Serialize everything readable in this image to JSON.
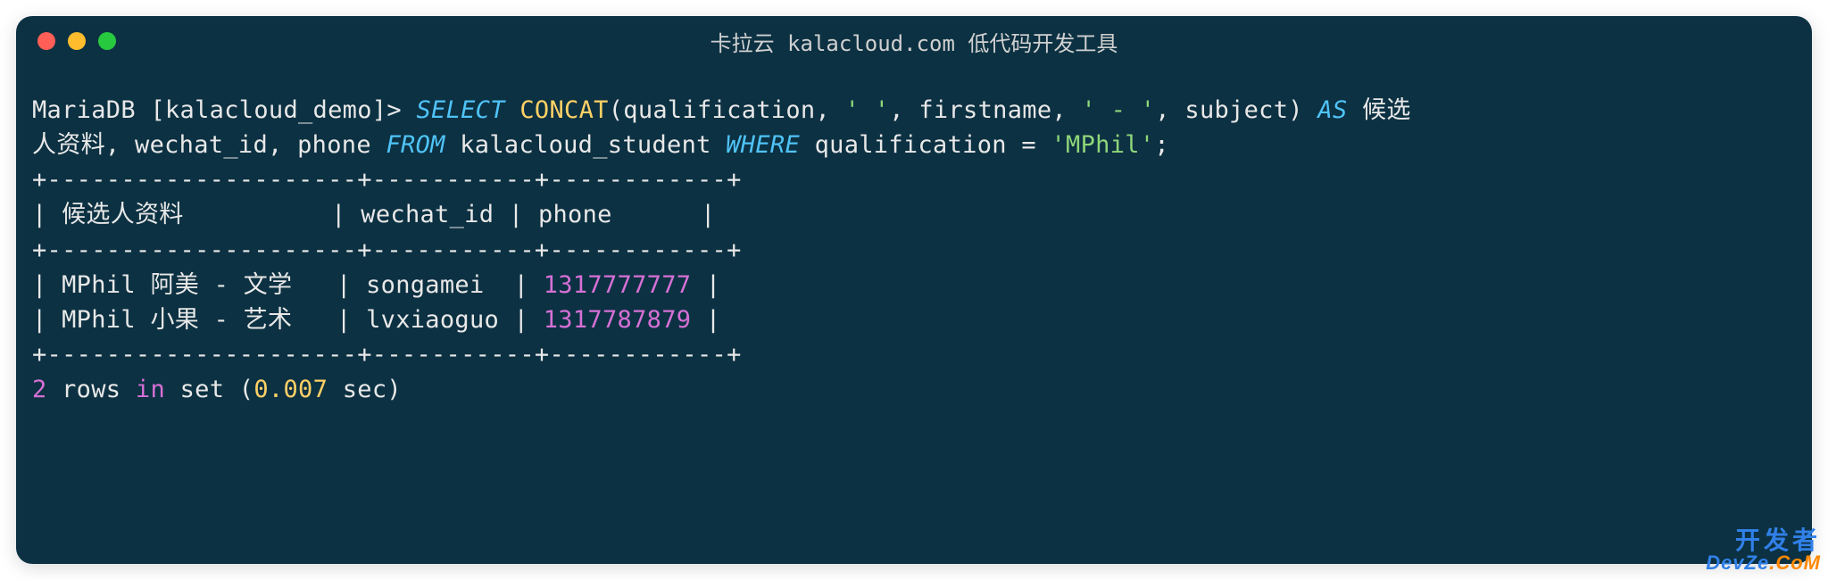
{
  "titlebar": {
    "title": "卡拉云 kalacloud.com 低代码开发工具"
  },
  "terminal": {
    "prompt": "MariaDB [kalacloud_demo]> ",
    "sql": {
      "select": "SELECT",
      "func": "CONCAT",
      "args_open": "(qualification, ",
      "str1": "' '",
      "comma1": ", firstname, ",
      "str2": "' - '",
      "comma2": ", subject) ",
      "as": "AS",
      "alias": " 候选",
      "alias2": "人资料, wechat_id, phone ",
      "from": "FROM",
      "table": " kalacloud_student ",
      "where": "WHERE",
      "cond_col": " qualification = ",
      "cond_val": "'MPhil'",
      "semicolon": ";"
    },
    "table": {
      "border_top": "+---------------------+-----------+------------+",
      "header": "| 候选人资料          | wechat_id | phone      |",
      "border_mid": "+---------------------+-----------+------------+",
      "row1_pre": "| MPhil 阿美 - 文学   | songamei  | ",
      "row1_phone": "1317777777",
      "row1_post": " |",
      "row2_pre": "| MPhil 小果 - 艺术   | lvxiaoguo | ",
      "row2_phone": "1317787879",
      "row2_post": " |",
      "border_bot": "+---------------------+-----------+------------+"
    },
    "summary": {
      "rows": "2",
      "rows_text": " rows ",
      "in": "in",
      "set_text": " set (",
      "sec": "0.007",
      "sec_text": " sec)"
    }
  },
  "watermark": {
    "line1": "开发者",
    "line2a": "DevZe",
    "line2b": ".CoM"
  }
}
